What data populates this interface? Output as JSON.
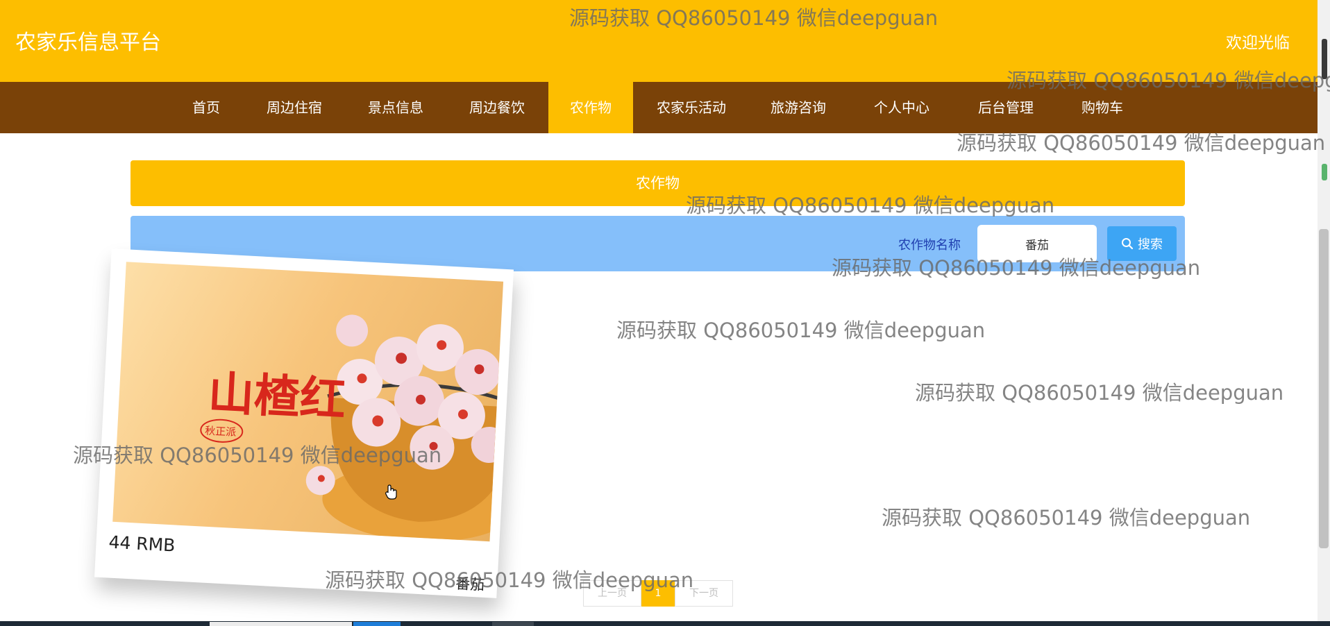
{
  "header": {
    "brand": "农家乐信息平台",
    "welcome": "欢迎光临"
  },
  "nav": {
    "items": [
      "首页",
      "周边住宿",
      "景点信息",
      "周边餐饮",
      "农作物",
      "农家乐活动",
      "旅游咨询",
      "个人中心",
      "后台管理",
      "购物车"
    ],
    "active": "农作物"
  },
  "section": {
    "title": "农作物"
  },
  "search": {
    "label": "农作物名称",
    "value": "番茄",
    "button_label": "搜索"
  },
  "products": [
    {
      "image_text": "山楂红",
      "image_seal": "秋正派",
      "price": "44 RMB",
      "name": "番茄"
    }
  ],
  "pagination": {
    "prev_label": "上一页",
    "current_page": "1",
    "next_label": "下一页"
  },
  "watermark": "源码获取 QQ86050149 微信deepguan",
  "colors": {
    "primary": "#FDBE00",
    "nav_background": "#7A4208",
    "search_background": "#85BFFA",
    "search_button": "#3DA5F4"
  }
}
